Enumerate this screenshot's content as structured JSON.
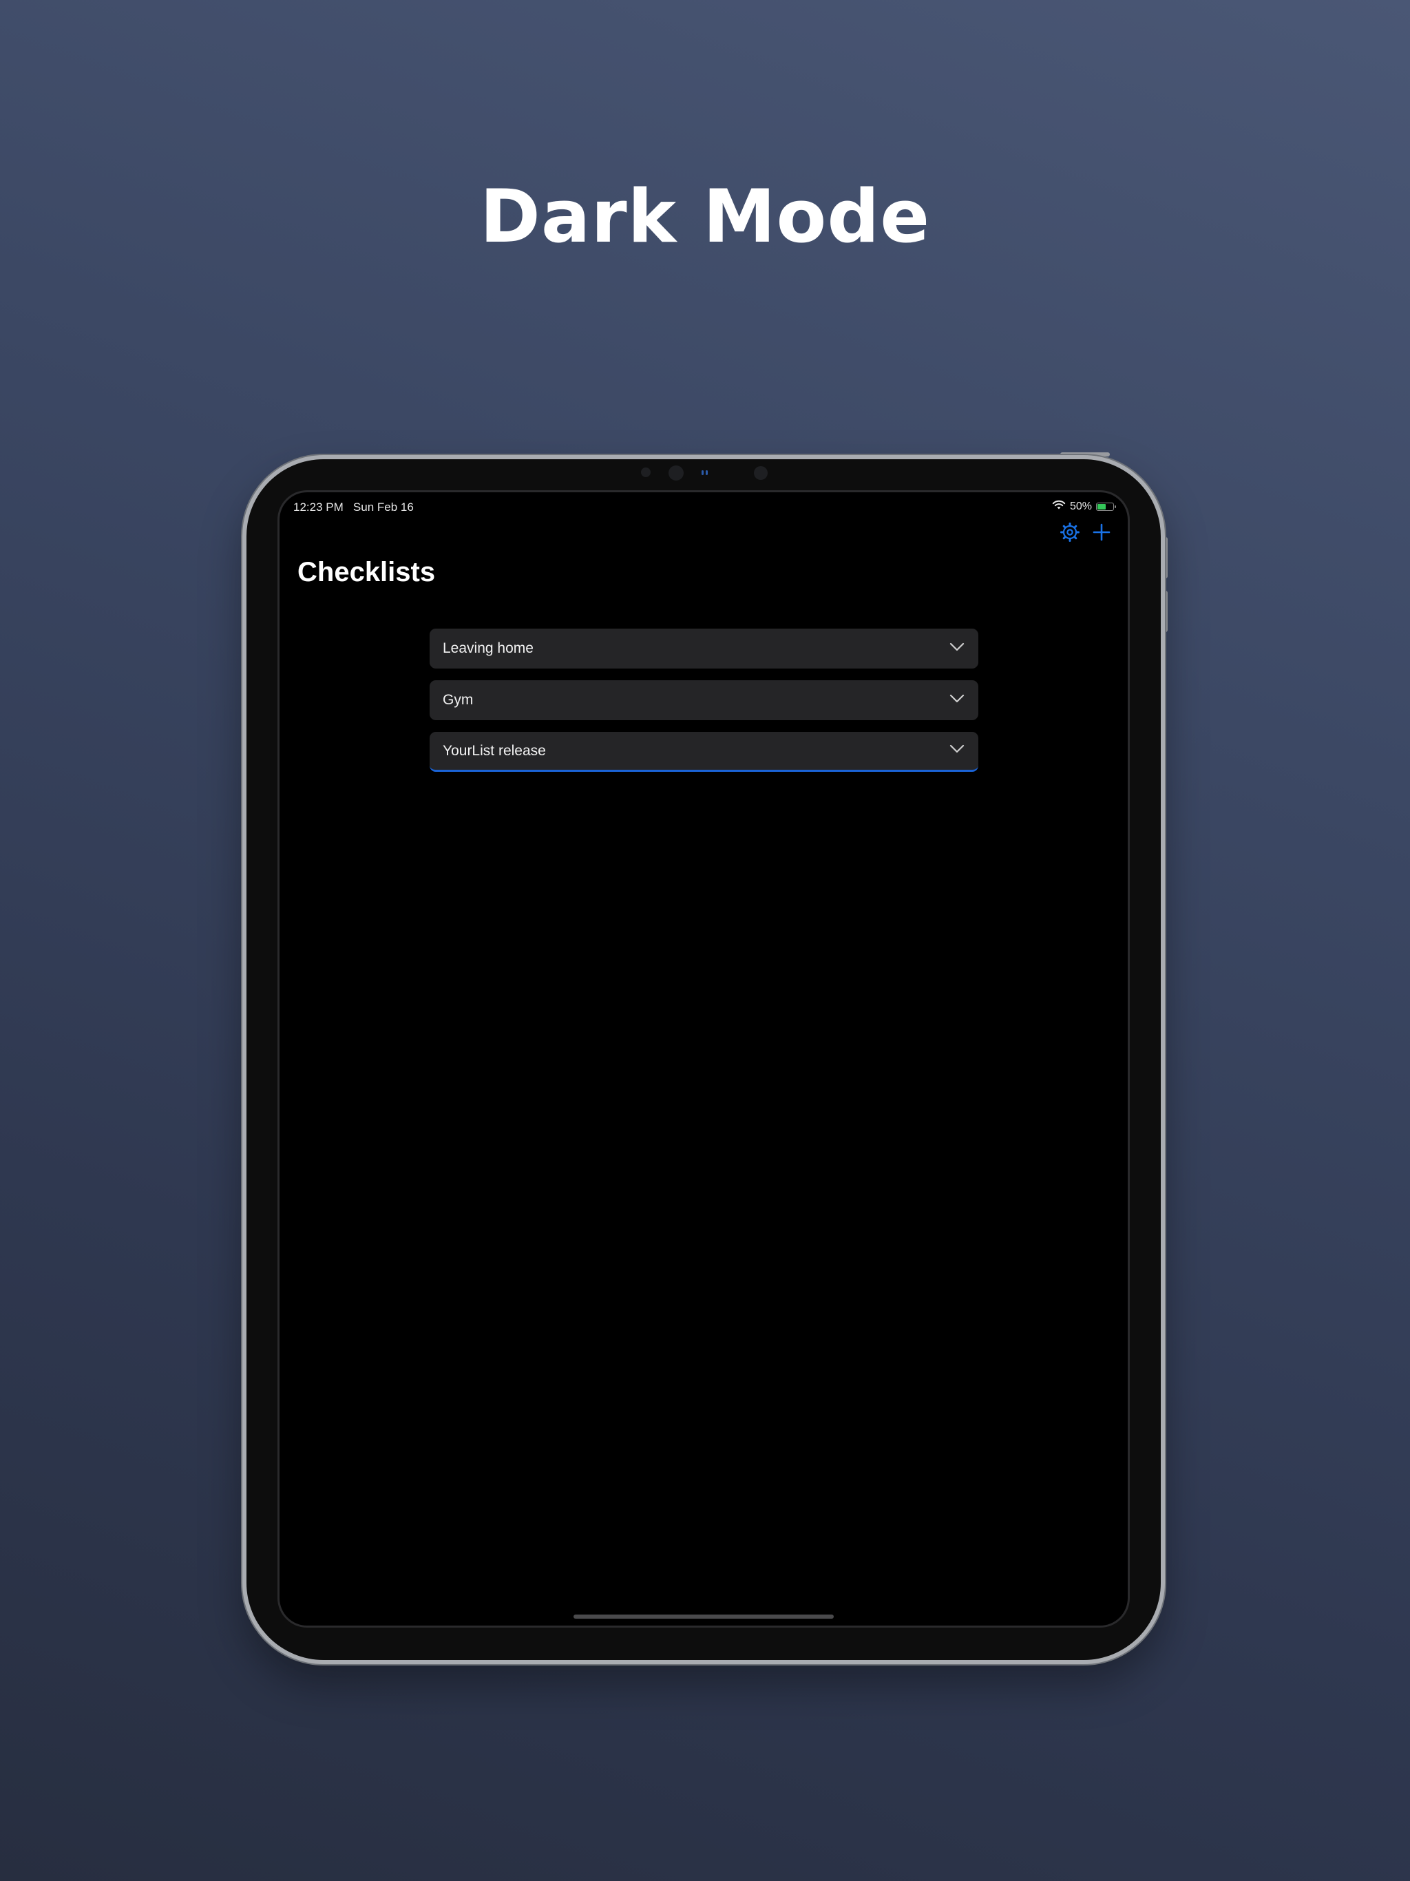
{
  "headline": "Dark Mode",
  "status_bar": {
    "time_date": "12:23 PM   Sun Feb 16",
    "battery_text": "50%",
    "battery_level": 0.5,
    "icons": [
      "wifi-icon",
      "battery-icon"
    ]
  },
  "nav": {
    "settings_icon": "gear-icon",
    "add_icon": "plus-icon",
    "accent_color": "#1a73e8"
  },
  "page": {
    "title": "Checklists"
  },
  "checklists": [
    {
      "label": "Leaving home",
      "icon": "chevron-down-icon"
    },
    {
      "label": "Gym",
      "icon": "chevron-down-icon"
    },
    {
      "label": "YourList release",
      "icon": "chevron-down-icon",
      "focused": true
    }
  ],
  "colors": {
    "screen_background": "#000000",
    "row_background": "#252527",
    "focus_underline": "#1a63d6"
  }
}
